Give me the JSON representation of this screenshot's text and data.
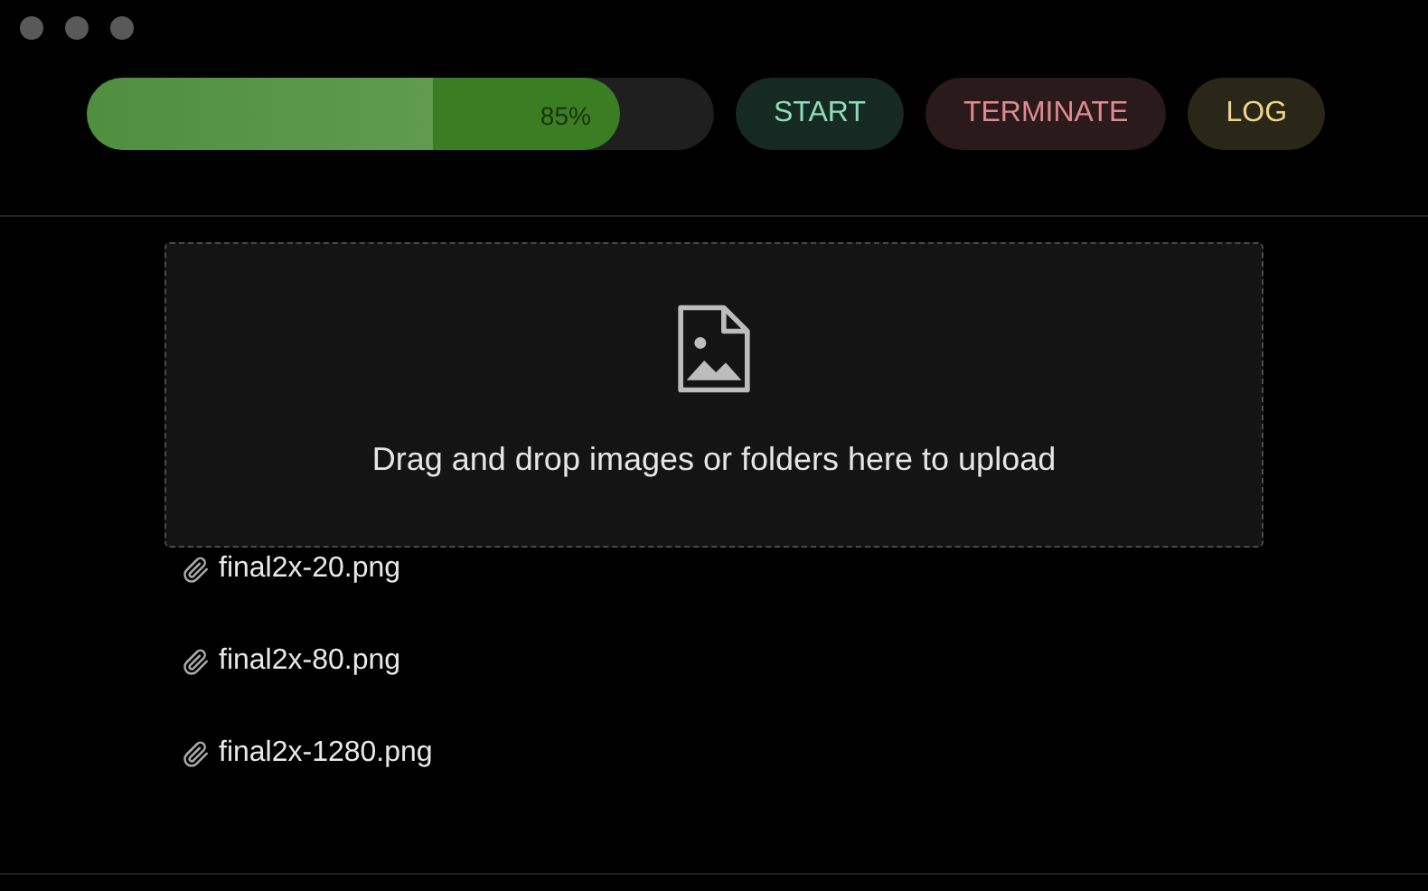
{
  "progress": {
    "level": 0.85,
    "reading": "85%"
  },
  "buttons": [
    {
      "label": "START",
      "kind": "start"
    },
    {
      "label": "TERMINATE",
      "kind": "terminate"
    },
    {
      "label": "LOG",
      "kind": "log"
    }
  ],
  "dropzone": {
    "text": "Drag and drop images or folders here to upload"
  },
  "files": [
    {
      "name": "final2x-20.png"
    },
    {
      "name": "final2x-80.png"
    },
    {
      "name": "final2x-1280.png"
    }
  ]
}
